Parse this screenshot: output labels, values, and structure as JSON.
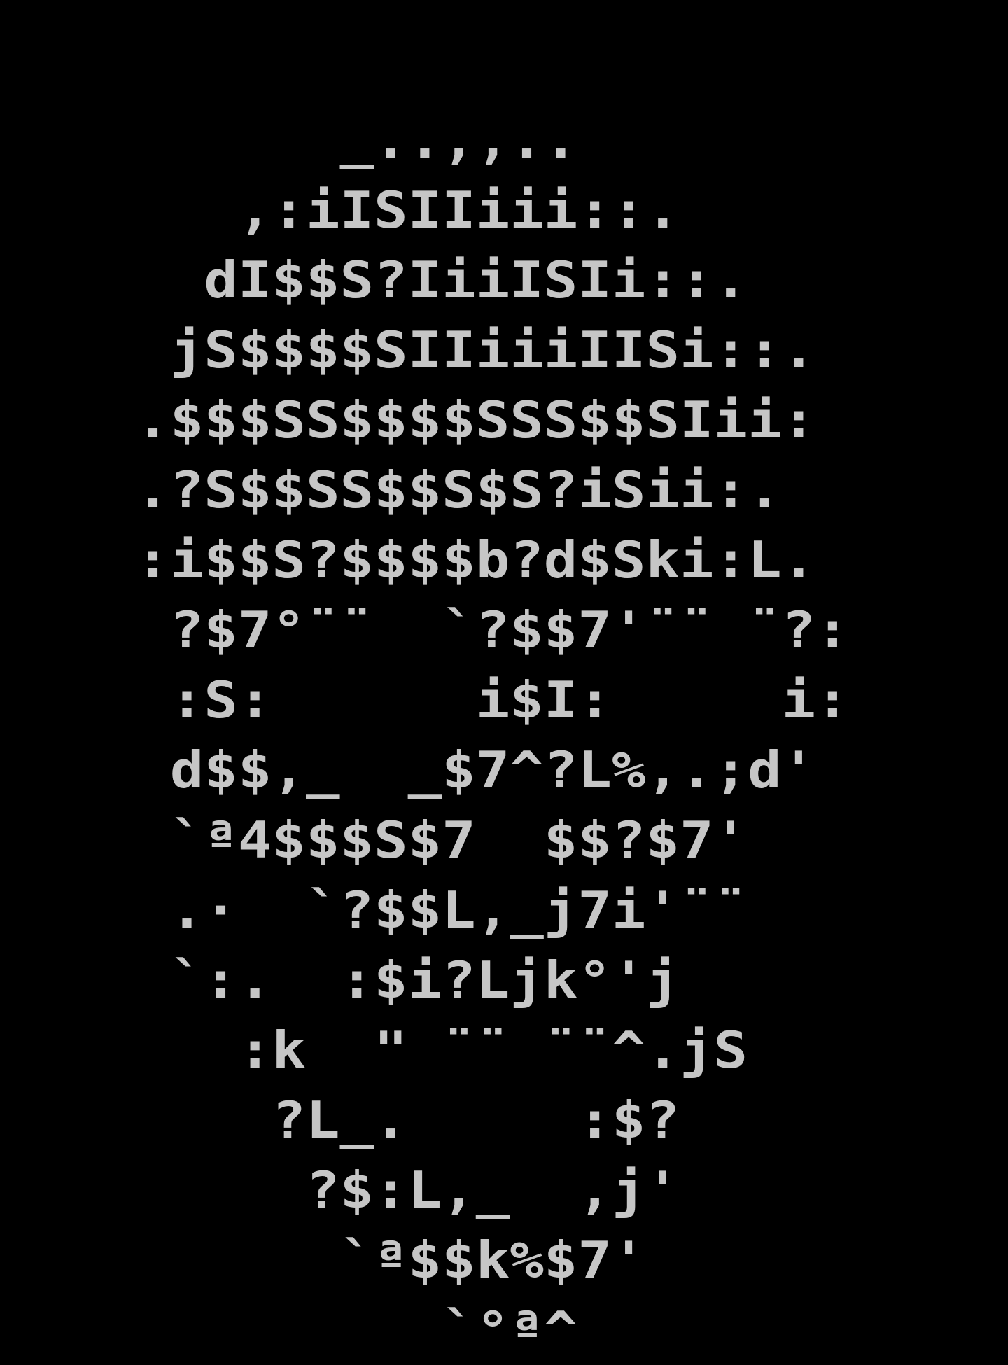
{
  "colors": {
    "background": "#000000",
    "text": "#c6c6c6"
  },
  "ascii_art": {
    "lines": [
      "          _..,,..",
      "       ,:iISIIiii::.",
      "      dI$$S?IiiISIi::.",
      "     jS$$$$SIIiiiIISi::.",
      "    .$$$SS$$$$SSS$$SIii:",
      "    .?S$$SS$$S$S?iSii:.",
      "    :i$$S?$$$$b?d$Ski:L.",
      "     ?$7°¨¨  `?$$7'¨¨ ¨?:",
      "     :S:      i$I:     i:",
      "     d$$,_  _$7^?L%,.;d'",
      "     `ª4$$$S$7  $$?$7'",
      "     .·  `?$$L,_j7i'¨¨",
      "     `:.  :$i?Ljk°'j",
      "       :k  \" ¨¨ ¨¨^.jS",
      "        ?L_.     :$?",
      "         ?$:L,_  ,j'",
      "          `ª$$k%$7'",
      "             `°ª^"
    ]
  }
}
